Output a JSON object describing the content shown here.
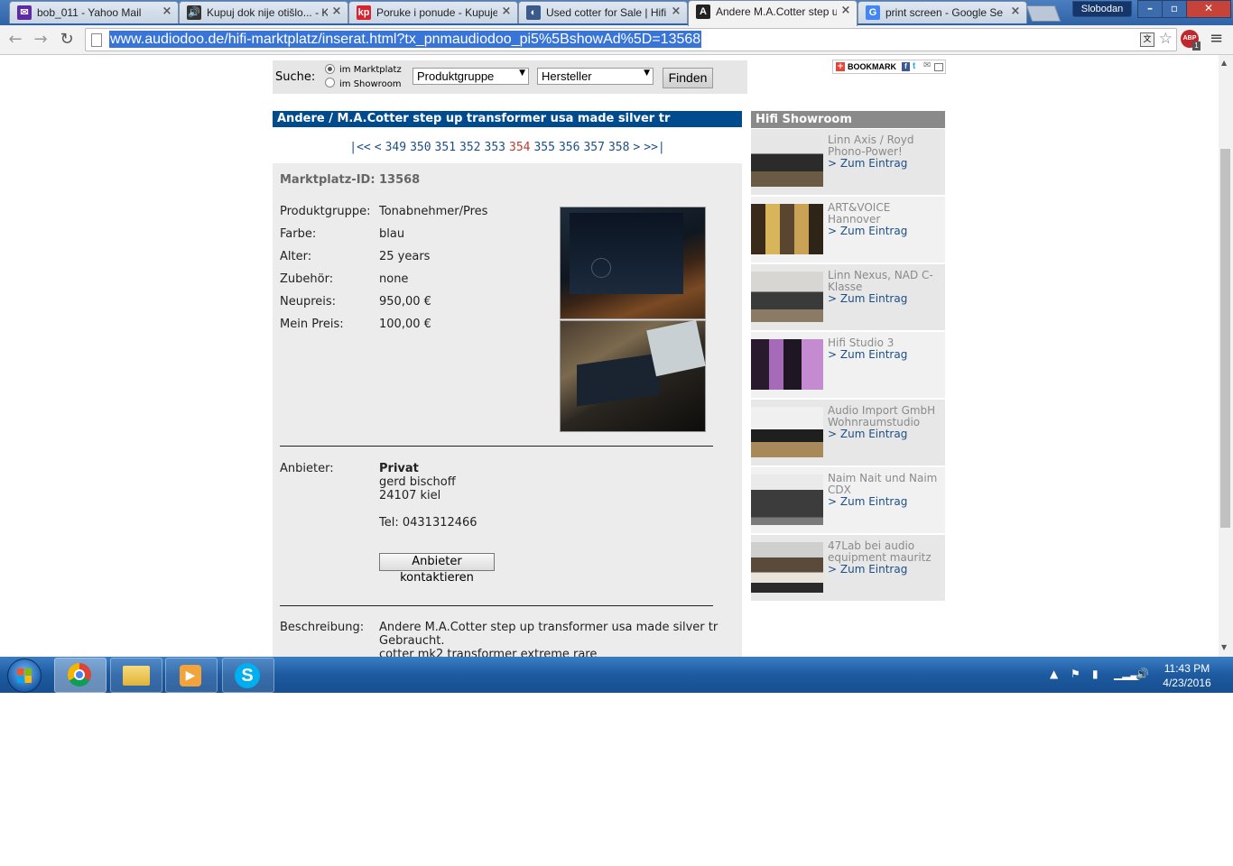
{
  "browser": {
    "tabs": [
      {
        "title": "bob_011 - Yahoo Mail",
        "icon": "mail-icon",
        "color": "#5f2ba5",
        "glyph": "✉"
      },
      {
        "title": "Kupuj dok nije otišlo... - K",
        "icon": "speaker-icon",
        "color": "#333333",
        "glyph": "🔊"
      },
      {
        "title": "Poruke i ponude - Kupuje",
        "icon": "kp-icon",
        "color": "#d9232e",
        "glyph": "kp"
      },
      {
        "title": "Used cotter for Sale | Hifi",
        "icon": "globe-icon",
        "color": "#3a5a8c",
        "glyph": "◐"
      },
      {
        "title": "Andere M.A.Cotter step u",
        "icon": "audiodoo-icon",
        "color": "#222222",
        "glyph": "A"
      },
      {
        "title": "print screen - Google Se",
        "icon": "google-icon",
        "color": "#4285f4",
        "glyph": "G"
      }
    ],
    "profile_name": "Slobodan",
    "url": "www.audiodoo.de/hifi-marktplatz/inserat.html?tx_pnmaudiodoo_pi5%5BshowAd%5D=13568",
    "abp_label": "ABP",
    "abp_count": "1"
  },
  "search": {
    "label": "Suche:",
    "radio_marketplace": "im Marktplatz",
    "radio_showroom": "im Showroom",
    "select_group": "Produktgruppe",
    "select_maker": "Hersteller",
    "find_button": "Finden",
    "bookmark_label": "BOOKMARK"
  },
  "listing": {
    "title": "Andere / M.A.Cotter step up transformer usa made silver tr",
    "pager": [
      "|<<",
      "<",
      "349",
      "350",
      "351",
      "352",
      "353",
      "354",
      "355",
      "356",
      "357",
      "358",
      ">",
      ">>|"
    ],
    "current_page": "354",
    "id_label": "Marktplatz-ID:",
    "id_value": "13568",
    "fields": [
      {
        "label": "Produktgruppe:",
        "value": "Tonabnehmer/Pres"
      },
      {
        "label": "Farbe:",
        "value": "blau"
      },
      {
        "label": "Alter:",
        "value": "25 years"
      },
      {
        "label": "Zubehör:",
        "value": "none"
      },
      {
        "label": "Neupreis:",
        "value": "950,00 €"
      },
      {
        "label": "Mein Preis:",
        "value": "100,00 €"
      }
    ],
    "seller_label": "Anbieter:",
    "seller_type": "Privat",
    "seller_name": "gerd bischoff",
    "seller_city": "24107 kiel",
    "seller_tel": "Tel: 0431312466",
    "contact_button": "Anbieter kontaktieren",
    "desc_label": "Beschreibung:",
    "desc_lines": [
      "Andere M.A.Cotter step up transformer usa made silver tr",
      "Gebraucht.",
      "cotter mk2 transformer extreme rare"
    ]
  },
  "showroom": {
    "title": "Hifi Showroom",
    "link_label": "> Zum Eintrag",
    "items": [
      {
        "name": "Linn Axis / Royd Phono-Power!"
      },
      {
        "name": "ART&VOICE Hannover"
      },
      {
        "name": "Linn Nexus, NAD C-Klasse"
      },
      {
        "name": "Hifi Studio 3"
      },
      {
        "name": "Audio Import GmbH Wohnraumstudio"
      },
      {
        "name": "Naim Nait und Naim CDX"
      },
      {
        "name": "47Lab bei audio equipment mauritz"
      }
    ]
  },
  "taskbar": {
    "time": "11:43 PM",
    "date": "4/23/2016"
  }
}
